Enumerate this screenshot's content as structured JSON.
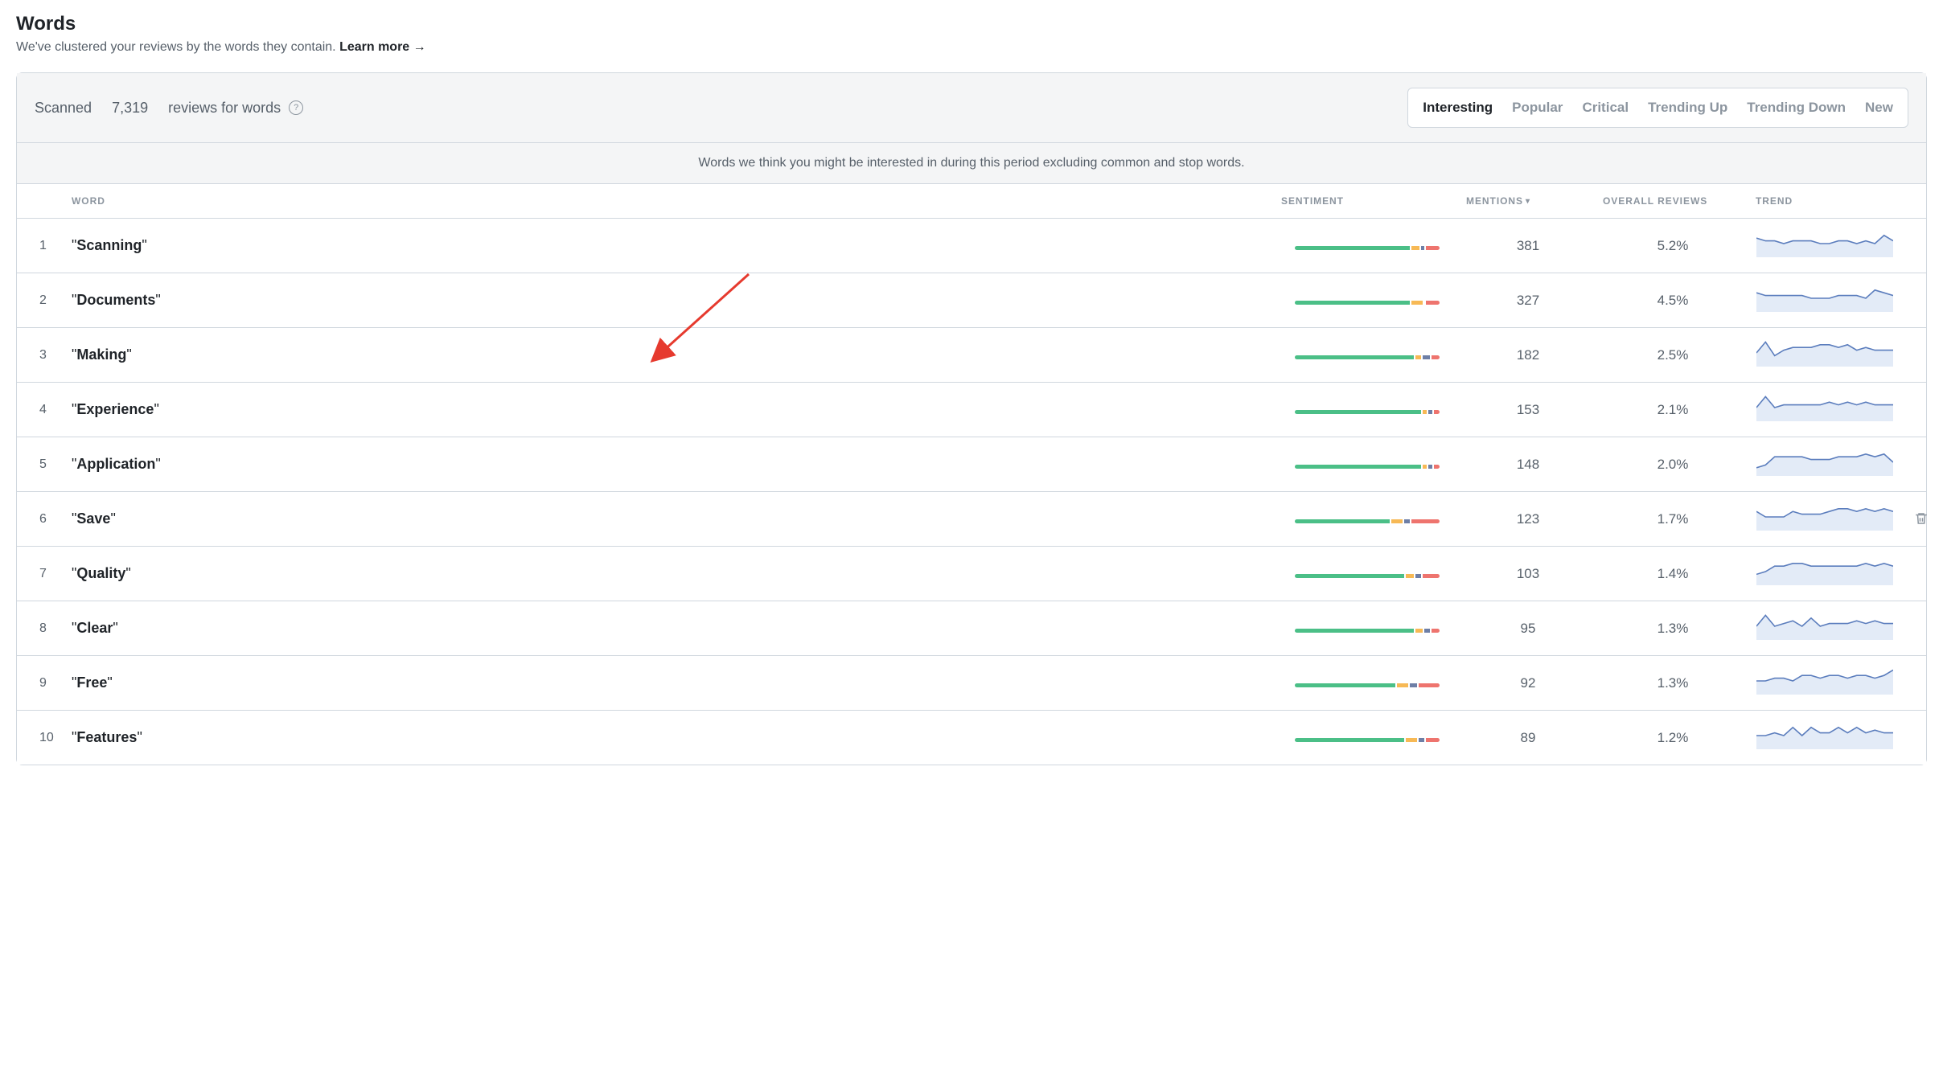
{
  "header": {
    "title": "Words",
    "subtitle": "We've clustered your reviews by the words they contain.",
    "learn_more": "Learn more",
    "arrow": "→"
  },
  "scanned": {
    "prefix": "Scanned",
    "count": "7,319",
    "suffix": "reviews for words"
  },
  "filters": [
    {
      "id": "interesting",
      "label": "Interesting",
      "active": true
    },
    {
      "id": "popular",
      "label": "Popular",
      "active": false
    },
    {
      "id": "critical",
      "label": "Critical",
      "active": false
    },
    {
      "id": "trending_up",
      "label": "Trending Up",
      "active": false
    },
    {
      "id": "trending_dn",
      "label": "Trending Down",
      "active": false
    },
    {
      "id": "new",
      "label": "New",
      "active": false
    }
  ],
  "description": "Words we think you might be interested in during this period excluding common and stop words.",
  "columns": {
    "word": "WORD",
    "sentiment": "SENTIMENT",
    "mentions": "MENTIONS",
    "overall": "OVERALL REVIEWS",
    "trend": "TREND"
  },
  "sort_by": "mentions",
  "rows": [
    {
      "idx": 1,
      "word": "Scanning",
      "mentions": 381,
      "overall": "5.2%",
      "sentiment": {
        "g": 82,
        "o": 6,
        "b": 2,
        "r": 10
      },
      "spark": [
        7,
        6,
        6,
        5,
        6,
        6,
        6,
        5,
        5,
        6,
        6,
        5,
        6,
        5,
        8,
        6
      ],
      "trash": false
    },
    {
      "idx": 2,
      "word": "Documents",
      "mentions": 327,
      "overall": "4.5%",
      "sentiment": {
        "g": 82,
        "o": 8,
        "b": 0,
        "r": 10
      },
      "spark": [
        7,
        6,
        6,
        6,
        6,
        6,
        5,
        5,
        5,
        6,
        6,
        6,
        5,
        8,
        7,
        6
      ],
      "trash": false
    },
    {
      "idx": 3,
      "word": "Making",
      "mentions": 182,
      "overall": "2.5%",
      "sentiment": {
        "g": 85,
        "o": 4,
        "b": 5,
        "r": 6
      },
      "spark": [
        5,
        9,
        4,
        6,
        7,
        7,
        7,
        8,
        8,
        7,
        8,
        6,
        7,
        6,
        6,
        6
      ],
      "trash": false
    },
    {
      "idx": 4,
      "word": "Experience",
      "mentions": 153,
      "overall": "2.1%",
      "sentiment": {
        "g": 90,
        "o": 3,
        "b": 3,
        "r": 4
      },
      "spark": [
        5,
        9,
        5,
        6,
        6,
        6,
        6,
        6,
        7,
        6,
        7,
        6,
        7,
        6,
        6,
        6
      ],
      "trash": false
    },
    {
      "idx": 5,
      "word": "Application",
      "mentions": 148,
      "overall": "2.0%",
      "sentiment": {
        "g": 90,
        "o": 3,
        "b": 3,
        "r": 4
      },
      "spark": [
        3,
        4,
        7,
        7,
        7,
        7,
        6,
        6,
        6,
        7,
        7,
        7,
        8,
        7,
        8,
        5
      ],
      "trash": false
    },
    {
      "idx": 6,
      "word": "Save",
      "mentions": 123,
      "overall": "1.7%",
      "sentiment": {
        "g": 68,
        "o": 8,
        "b": 4,
        "r": 20
      },
      "spark": [
        7,
        5,
        5,
        5,
        7,
        6,
        6,
        6,
        7,
        8,
        8,
        7,
        8,
        7,
        8,
        7
      ],
      "trash": true
    },
    {
      "idx": 7,
      "word": "Quality",
      "mentions": 103,
      "overall": "1.4%",
      "sentiment": {
        "g": 78,
        "o": 6,
        "b": 4,
        "r": 12
      },
      "spark": [
        4,
        5,
        7,
        7,
        8,
        8,
        7,
        7,
        7,
        7,
        7,
        7,
        8,
        7,
        8,
        7
      ],
      "trash": false
    },
    {
      "idx": 8,
      "word": "Clear",
      "mentions": 95,
      "overall": "1.3%",
      "sentiment": {
        "g": 85,
        "o": 5,
        "b": 4,
        "r": 6
      },
      "spark": [
        5,
        9,
        5,
        6,
        7,
        5,
        8,
        5,
        6,
        6,
        6,
        7,
        6,
        7,
        6,
        6
      ],
      "trash": false
    },
    {
      "idx": 9,
      "word": "Free",
      "mentions": 92,
      "overall": "1.3%",
      "sentiment": {
        "g": 72,
        "o": 8,
        "b": 5,
        "r": 15
      },
      "spark": [
        5,
        5,
        6,
        6,
        5,
        7,
        7,
        6,
        7,
        7,
        6,
        7,
        7,
        6,
        7,
        9
      ],
      "trash": false
    },
    {
      "idx": 10,
      "word": "Features",
      "mentions": 89,
      "overall": "1.2%",
      "sentiment": {
        "g": 78,
        "o": 8,
        "b": 4,
        "r": 10
      },
      "spark": [
        5,
        5,
        6,
        5,
        8,
        5,
        8,
        6,
        6,
        8,
        6,
        8,
        6,
        7,
        6,
        6
      ],
      "trash": false
    }
  ]
}
